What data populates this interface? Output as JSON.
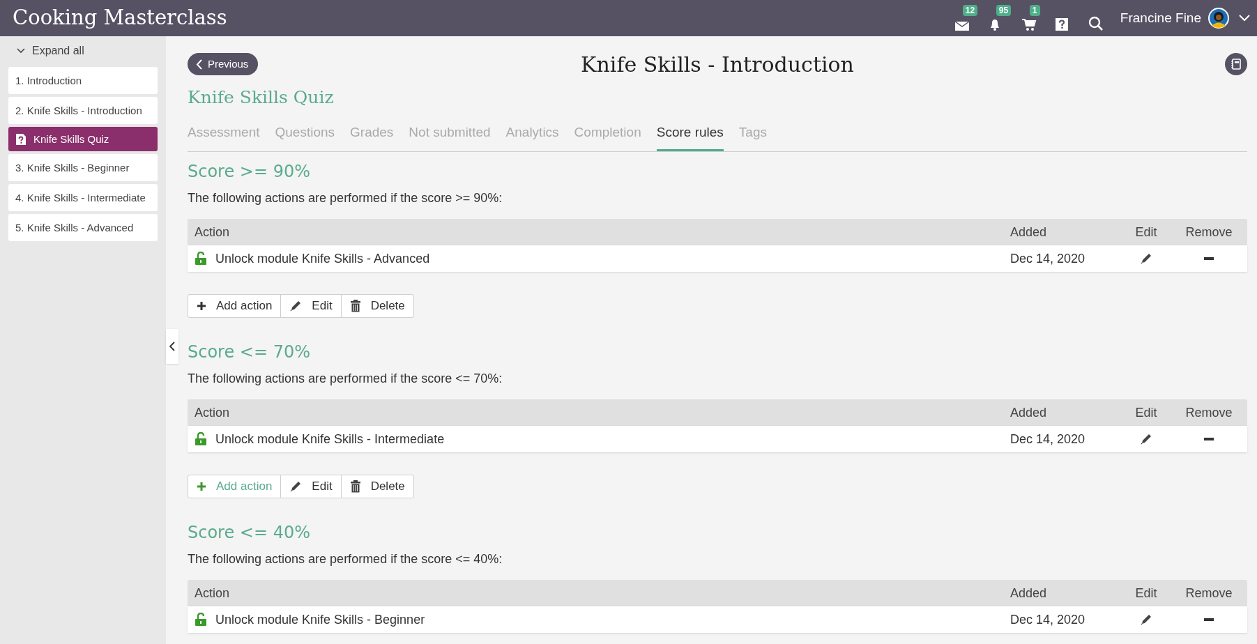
{
  "header": {
    "title": "Cooking Masterclass",
    "icons": [
      {
        "kind": "mail",
        "badge": "12"
      },
      {
        "kind": "bell",
        "badge": "95"
      },
      {
        "kind": "cart",
        "badge": "1"
      },
      {
        "kind": "help"
      },
      {
        "kind": "search"
      }
    ],
    "user_name": "Francine Fine"
  },
  "sidebar": {
    "expand_label": "Expand all",
    "items": [
      {
        "label": "1. Introduction",
        "kind": "lesson",
        "selected": false
      },
      {
        "label": "2. Knife Skills - Introduction",
        "kind": "lesson",
        "selected": false
      },
      {
        "label": "Knife Skills Quiz",
        "kind": "quiz",
        "selected": true
      },
      {
        "label": "3. Knife Skills - Beginner",
        "kind": "lesson",
        "selected": false
      },
      {
        "label": "4. Knife Skills - Intermediate",
        "kind": "lesson",
        "selected": false
      },
      {
        "label": "5. Knife Skills - Advanced",
        "kind": "lesson",
        "selected": false
      }
    ]
  },
  "previous_label": "Previous",
  "page_title": "Knife Skills - Introduction",
  "quiz_title": "Knife Skills Quiz",
  "tabs": [
    {
      "label": "Assessment",
      "selected": false
    },
    {
      "label": "Questions",
      "selected": false
    },
    {
      "label": "Grades",
      "selected": false
    },
    {
      "label": "Not submitted",
      "selected": false
    },
    {
      "label": "Analytics",
      "selected": false
    },
    {
      "label": "Completion",
      "selected": false
    },
    {
      "label": "Score rules",
      "selected": true
    },
    {
      "label": "Tags",
      "selected": false
    }
  ],
  "rules": [
    {
      "heading": "Score >= 90%",
      "description": "The following actions are performed if the score >= 90%:",
      "columns": [
        "Action",
        "Added",
        "Edit",
        "Remove"
      ],
      "rows": [
        {
          "action": "Unlock module Knife Skills - Advanced",
          "added": "Dec 14, 2020"
        }
      ],
      "toolbar": [
        {
          "kind": "add",
          "label": "Add action",
          "hovered": false
        },
        {
          "kind": "edit",
          "label": "Edit",
          "hovered": false
        },
        {
          "kind": "delete",
          "label": "Delete",
          "hovered": false
        }
      ]
    },
    {
      "heading": "Score <= 70%",
      "description": "The following actions are performed if the score <= 70%:",
      "columns": [
        "Action",
        "Added",
        "Edit",
        "Remove"
      ],
      "rows": [
        {
          "action": "Unlock module Knife Skills - Intermediate",
          "added": "Dec 14, 2020"
        }
      ],
      "toolbar": [
        {
          "kind": "add",
          "label": "Add action",
          "hovered": true
        },
        {
          "kind": "edit",
          "label": "Edit",
          "hovered": false
        },
        {
          "kind": "delete",
          "label": "Delete",
          "hovered": false
        }
      ]
    },
    {
      "heading": "Score <= 40%",
      "description": "The following actions are performed if the score <= 40%:",
      "columns": [
        "Action",
        "Added",
        "Edit",
        "Remove"
      ],
      "rows": [
        {
          "action": "Unlock module Knife Skills - Beginner",
          "added": "Dec 14, 2020"
        }
      ]
    }
  ]
}
